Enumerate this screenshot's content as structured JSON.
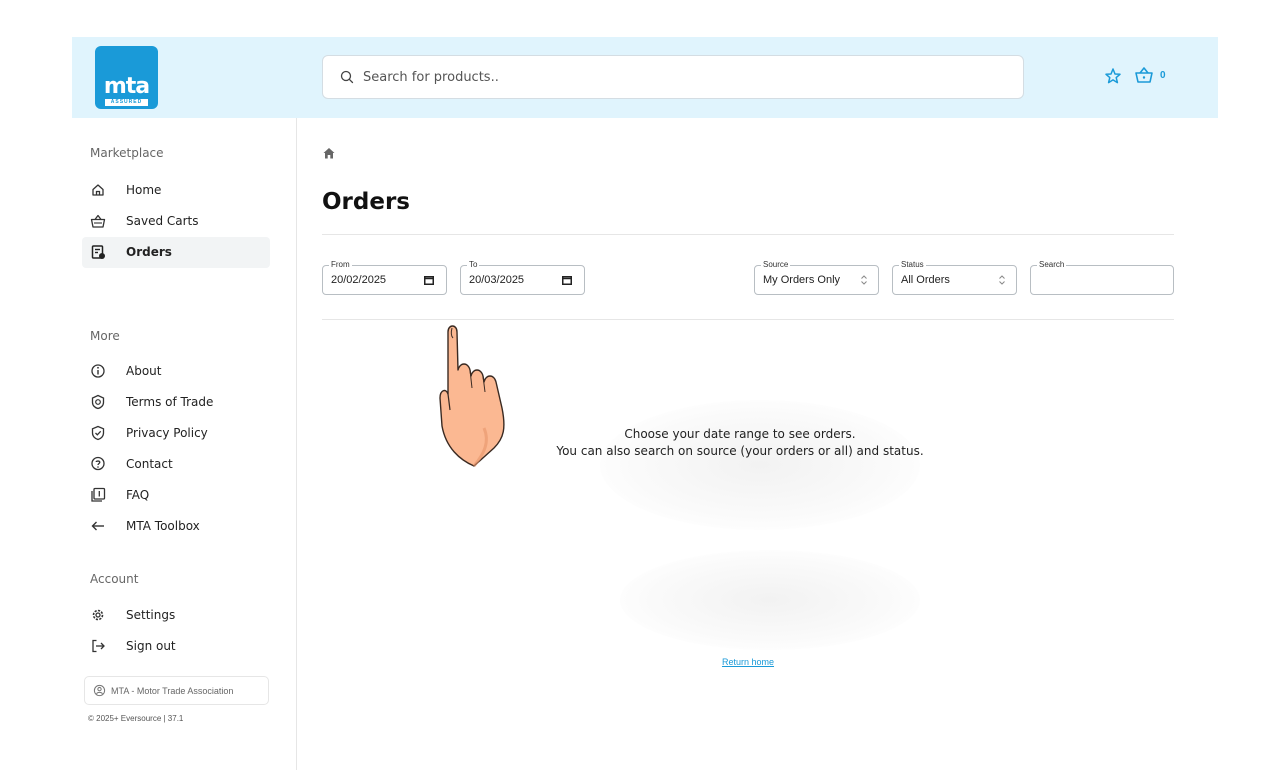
{
  "header": {
    "logo_text": "mta",
    "logo_sub": "ASSURED",
    "search_placeholder": "Search for products..",
    "cart_count": "0"
  },
  "sidebar": {
    "sections": [
      {
        "title": "Marketplace"
      },
      {
        "title": "More"
      },
      {
        "title": "Account"
      }
    ],
    "marketplace_items": [
      {
        "label": "Home",
        "icon": "home-icon"
      },
      {
        "label": "Saved Carts",
        "icon": "basket-icon"
      },
      {
        "label": "Orders",
        "icon": "orders-icon",
        "active": true
      }
    ],
    "more_items": [
      {
        "label": "About",
        "icon": "info-icon"
      },
      {
        "label": "Terms of Trade",
        "icon": "badge-icon"
      },
      {
        "label": "Privacy Policy",
        "icon": "shield-icon"
      },
      {
        "label": "Contact",
        "icon": "question-icon"
      },
      {
        "label": "FAQ",
        "icon": "faq-icon"
      },
      {
        "label": "MTA Toolbox",
        "icon": "arrow-left-icon"
      }
    ],
    "account_items": [
      {
        "label": "Settings",
        "icon": "gear-icon"
      },
      {
        "label": "Sign out",
        "icon": "sign-out-icon"
      }
    ],
    "organisation": "MTA - Motor Trade Association",
    "copyright": "© 2025+ Eversource | 37.1"
  },
  "main": {
    "title": "Orders",
    "filters": {
      "from_label": "From",
      "from_value": "20/02/2025",
      "to_label": "To",
      "to_value": "20/03/2025",
      "source_label": "Source",
      "source_value": "My Orders Only",
      "status_label": "Status",
      "status_value": "All Orders",
      "search_label": "Search",
      "search_value": ""
    },
    "empty_line1": "Choose your date range to see orders.",
    "empty_line2": "You can also search on source (your orders or all) and status.",
    "return_link": "Return home"
  },
  "colors": {
    "brand": "#1a9ad8",
    "header_bg": "#e0f4fd",
    "active_bg": "#f2f4f5"
  }
}
